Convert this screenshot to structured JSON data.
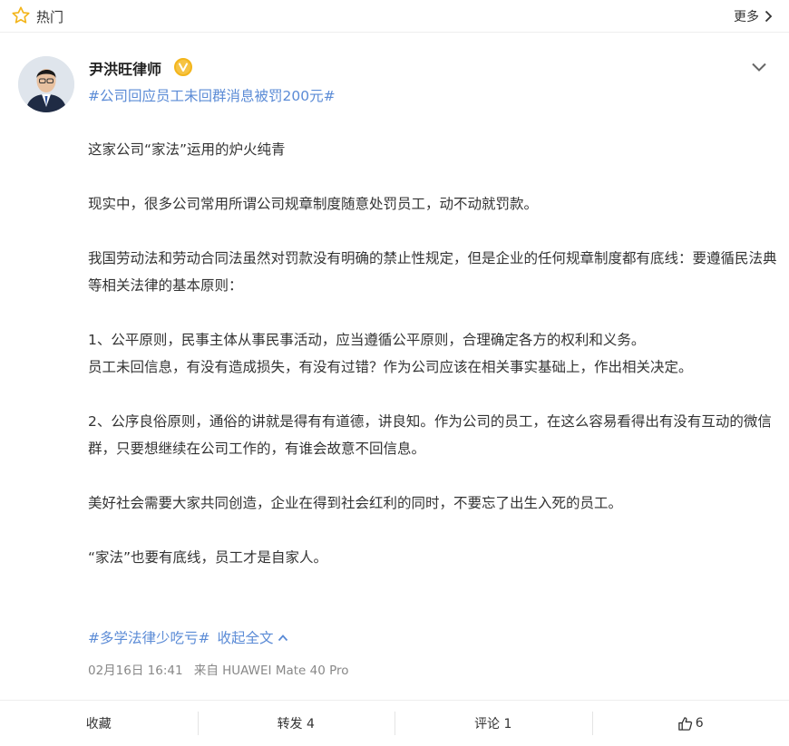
{
  "header": {
    "hot_label": "热门",
    "more_label": "更多"
  },
  "post": {
    "author": "尹洪旺律师",
    "topic": "#公司回应员工未回群消息被罚200元#",
    "paragraphs": [
      "这家公司“家法”运用的炉火纯青",
      "现实中，很多公司常用所谓公司规章制度随意处罚员工，动不动就罚款。",
      "我国劳动法和劳动合同法虽然对罚款没有明确的禁止性规定，但是企业的任何规章制度都有底线：要遵循民法典等相关法律的基本原则：",
      "1、公平原则，民事主体从事民事活动，应当遵循公平原则，合理确定各方的权利和义务。",
      "员工未回信息，有没有造成损失，有没有过错？作为公司应该在相关事实基础上，作出相关决定。",
      "2、公序良俗原则，通俗的讲就是得有有道德，讲良知。作为公司的员工，在这么容易看得出有没有互动的微信群，只要想继续在公司工作的，有谁会故意不回信息。",
      "美好社会需要大家共同创造，企业在得到社会红利的同时，不要忘了出生入死的员工。",
      "“家法”也要有底线，员工才是自家人。"
    ],
    "tag": "#多学法律少吃亏#",
    "collapse_label": "收起全文",
    "date": "02月16日 16:41",
    "source": "来自 HUAWEI Mate 40 Pro"
  },
  "actions": {
    "favorite": "收藏",
    "repost": "转发 4",
    "comment": "评论 1",
    "like_count": "6"
  },
  "colors": {
    "link": "#5b8bd6",
    "star": "#f3b51b"
  }
}
